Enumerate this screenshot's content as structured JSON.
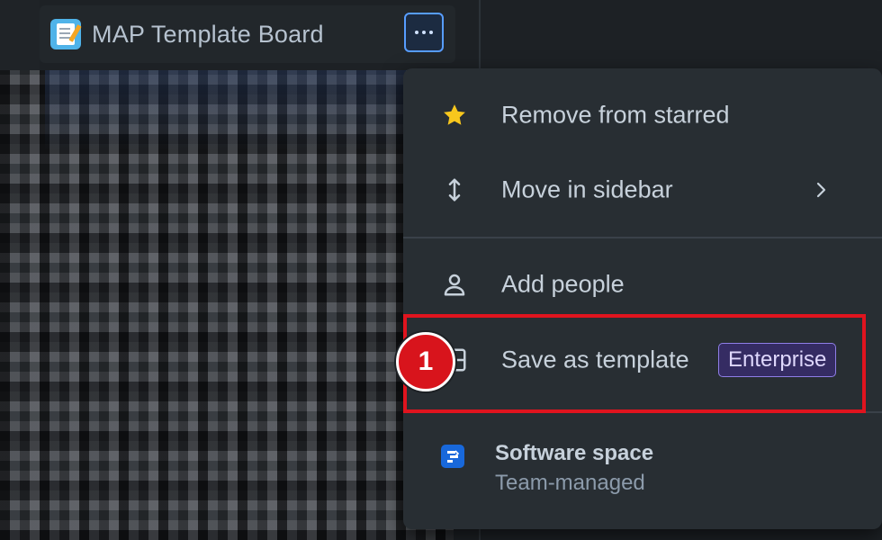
{
  "board": {
    "title": "MAP Template Board",
    "icon": "board-notes-icon",
    "more_icon": "more-horizontal-icon"
  },
  "menu": {
    "items": [
      {
        "label": "Remove from starred",
        "icon": "star-filled-icon"
      },
      {
        "label": "Move in sidebar",
        "icon": "move-vertical-icon",
        "submenu_icon": "chevron-right-icon"
      },
      {
        "label": "Add people",
        "icon": "person-icon"
      },
      {
        "label": "Save as template",
        "icon": "template-icon",
        "badge": "Enterprise"
      }
    ],
    "space": {
      "title": "Software space",
      "subtitle": "Team-managed",
      "icon": "jira-software-icon"
    }
  },
  "annotation": {
    "step_number": "1"
  },
  "colors": {
    "highlight": "#e0141e",
    "star": "#f8c71d",
    "badge_bg": "#352c63",
    "badge_border": "#8f7ee7",
    "focus_border": "#579dff"
  }
}
